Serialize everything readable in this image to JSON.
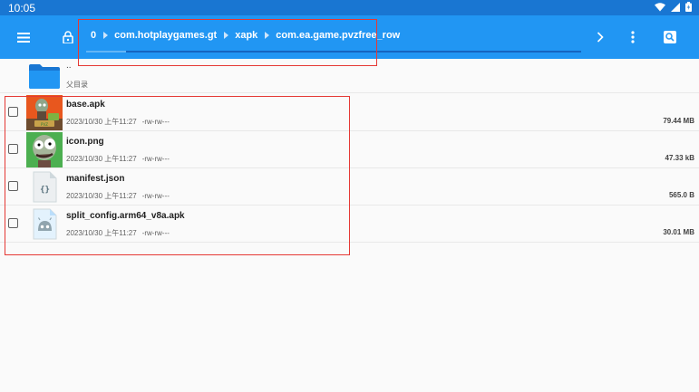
{
  "status_bar": {
    "time": "10:05"
  },
  "toolbar": {
    "path": [
      "0",
      "com.hotplaygames.gt",
      "xapk",
      "com.ea.game.pvzfree_row"
    ],
    "progress": 0.08
  },
  "parent_dir": {
    "name": "..",
    "label": "父目录"
  },
  "files": [
    {
      "name": "base.apk",
      "date": "2023/10/30 上午11:27",
      "perm": "-rw-rw---",
      "size": "79.44 MB",
      "icon": "pvz-app-icon"
    },
    {
      "name": "icon.png",
      "date": "2023/10/30 上午11:27",
      "perm": "-rw-rw---",
      "size": "47.33 kB",
      "icon": "zombie-image-icon"
    },
    {
      "name": "manifest.json",
      "date": "2023/10/30 上午11:27",
      "perm": "-rw-rw---",
      "size": "565.0 B",
      "icon": "json-file-icon"
    },
    {
      "name": "split_config.arm64_v8a.apk",
      "date": "2023/10/30 上午11:27",
      "perm": "-rw-rw---",
      "size": "30.01 MB",
      "icon": "android-apk-icon"
    }
  ],
  "colors": {
    "primary": "#2196f3",
    "status_bar": "#1976d2",
    "highlight": "#e53935",
    "folder": "#1976d2"
  }
}
